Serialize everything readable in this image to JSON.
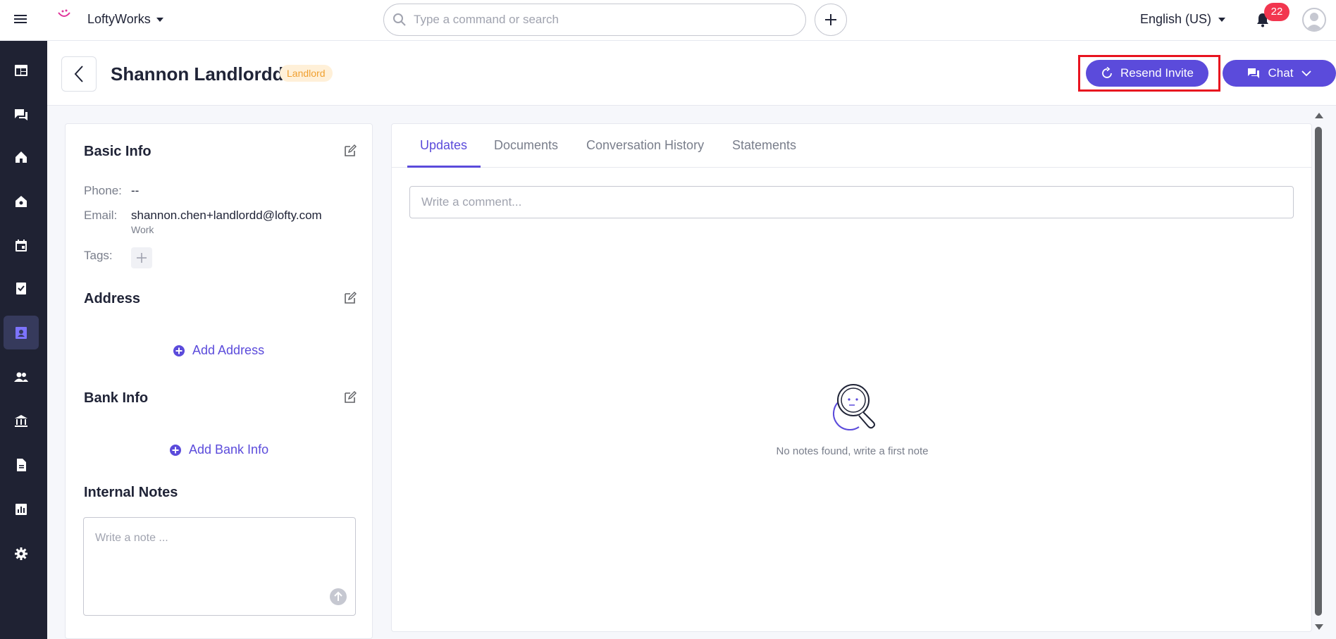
{
  "topbar": {
    "brand": "LoftyWorks",
    "search_placeholder": "Type a command or search",
    "language": "English (US)",
    "notification_count": "22"
  },
  "header": {
    "title": "Shannon Landlordd",
    "role_badge": "Landlord",
    "resend_label": "Resend Invite",
    "chat_label": "Chat"
  },
  "basic_info": {
    "title": "Basic Info",
    "phone_label": "Phone:",
    "phone_value": "--",
    "email_label": "Email:",
    "email_value": "shannon.chen+landlordd@lofty.com",
    "email_type": "Work",
    "tags_label": "Tags:"
  },
  "address": {
    "title": "Address",
    "add_label": "Add Address"
  },
  "bank_info": {
    "title": "Bank Info",
    "add_label": "Add Bank Info"
  },
  "internal_notes": {
    "title": "Internal Notes",
    "placeholder": "Write a note ..."
  },
  "tabs": [
    {
      "label": "Updates"
    },
    {
      "label": "Documents"
    },
    {
      "label": "Conversation History"
    },
    {
      "label": "Statements"
    }
  ],
  "updates": {
    "comment_placeholder": "Write a comment...",
    "empty_text": "No notes found, write a first note"
  },
  "colors": {
    "accent": "#5b4bdb",
    "sidebar": "#1f2233",
    "highlight": "#e8131f",
    "badge": "#f2364f"
  }
}
